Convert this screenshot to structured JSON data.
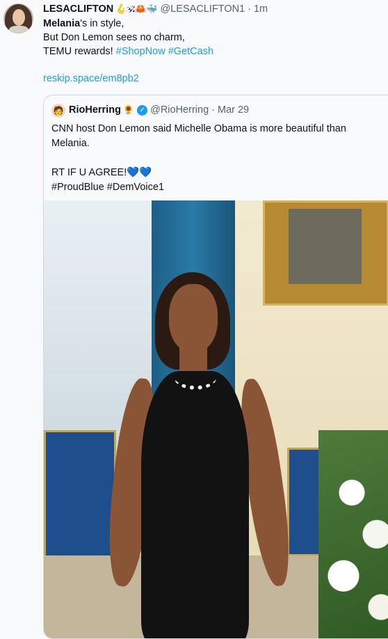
{
  "post": {
    "author_name": "LESACLIFTON",
    "author_emojis": "🪝🕉🦀🐳",
    "handle": "@LESACLIFTON1",
    "separator": "·",
    "time": "1m",
    "line1_bold": "Melania",
    "line1_rest": "'s in style,",
    "line2": "But Don Lemon sees no charm,",
    "line3_text": "TEMU rewards! ",
    "hashtag1": "#ShopNow",
    "hashtag2": "#GetCash",
    "link": "reskip.space/em8pb2"
  },
  "quoted": {
    "avatar_emoji": "🧑",
    "author_name": "RioHerring",
    "author_emoji": "🌻",
    "verified_icon": "✓",
    "handle": "@RioHerring",
    "separator": "·",
    "date": "Mar 29",
    "text_line1": "CNN host Don Lemon said Michelle Obama is more beautiful than",
    "text_line2": "Melania.",
    "text_line3": "RT IF U AGREE!",
    "hearts": "💙💙",
    "hashtags": "#ProudBlue #DemVoice1"
  },
  "colors": {
    "link": "#1d9bf0",
    "secondary_text": "#536471",
    "background": "#f7f9fa",
    "border": "#cfd9de"
  },
  "icons": [
    "avatar",
    "verified-badge-icon",
    "photo"
  ]
}
